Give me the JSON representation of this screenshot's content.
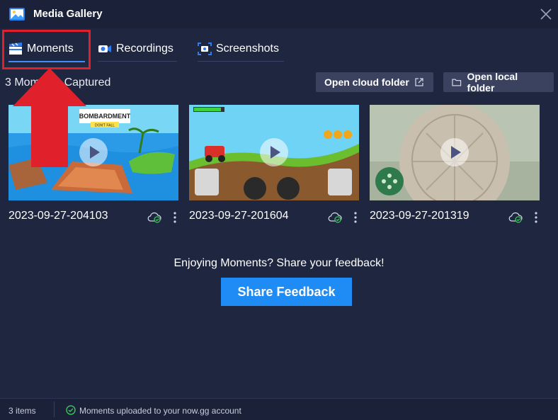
{
  "window": {
    "title": "Media Gallery"
  },
  "tabs": [
    {
      "label": "Moments",
      "active": true
    },
    {
      "label": "Recordings",
      "active": false
    },
    {
      "label": "Screenshots",
      "active": false
    }
  ],
  "captured_label": "3 Moments Captured",
  "buttons": {
    "open_cloud": "Open cloud folder",
    "open_local": "Open local folder",
    "share_feedback": "Share Feedback"
  },
  "moments": [
    {
      "date": "2023-09-27-204103",
      "thumb_text": "BOMBARDMENT",
      "thumb_sub": "DON'T FALL"
    },
    {
      "date": "2023-09-27-201604"
    },
    {
      "date": "2023-09-27-201319"
    }
  ],
  "feedback_prompt": "Enjoying Moments? Share your feedback!",
  "status": {
    "items": "3 items",
    "upload": "Moments uploaded to your now.gg account"
  },
  "colors": {
    "accent": "#3f8cff",
    "highlight": "#e0202a",
    "success": "#3cc35a",
    "button_primary": "#1f8cf5"
  },
  "icons": [
    "gallery-icon",
    "close-icon",
    "clapperboard-icon",
    "camera-icon",
    "screenshot-icon",
    "external-link-icon",
    "folder-icon",
    "cloud-check-icon",
    "kebab-icon",
    "check-circle-icon",
    "play-icon"
  ]
}
